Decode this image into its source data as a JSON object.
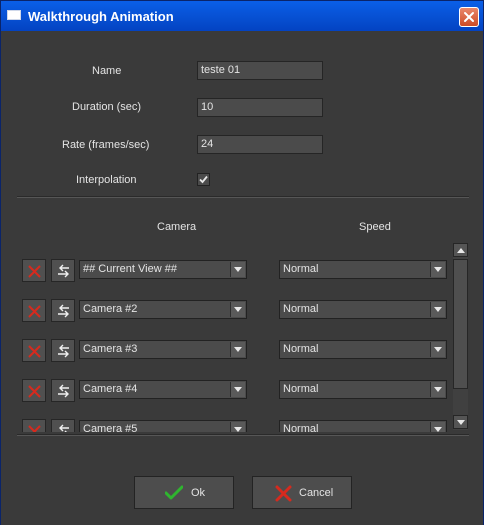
{
  "window": {
    "title": "Walkthrough Animation"
  },
  "form": {
    "name_label": "Name",
    "name_value": "teste 01",
    "duration_label": "Duration (sec)",
    "duration_value": "10",
    "rate_label": "Rate (frames/sec)",
    "rate_value": "24",
    "interpolation_label": "Interpolation",
    "interpolation_checked": true
  },
  "table": {
    "camera_header": "Camera",
    "speed_header": "Speed",
    "rows": [
      {
        "camera": "## Current View ##",
        "speed": "Normal"
      },
      {
        "camera": "Camera #2",
        "speed": "Normal"
      },
      {
        "camera": "Camera #3",
        "speed": "Normal"
      },
      {
        "camera": "Camera #4",
        "speed": "Normal"
      },
      {
        "camera": "Camera #5",
        "speed": "Normal"
      }
    ]
  },
  "buttons": {
    "ok_label": "Ok",
    "cancel_label": "Cancel"
  },
  "colors": {
    "title_bar": "#0854d8",
    "panel_bg": "#3a3a3a",
    "ok_check": "#2fb52f",
    "cancel_x": "#d62a1e"
  },
  "icons": {
    "title": "window-icon",
    "close": "close-icon",
    "delete": "delete-x-icon",
    "move": "swap-arrows-icon",
    "ok": "checkmark-icon",
    "cancel": "cancel-x-icon"
  }
}
